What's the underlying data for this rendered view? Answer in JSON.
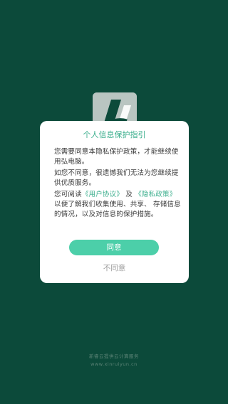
{
  "background_color": "#0c4a3a",
  "accent_color": "#3aae8c",
  "button_color": "#4ccfa9",
  "logo": {
    "icon": "app-logo-icon"
  },
  "dialog": {
    "title": "个人信息保护指引",
    "p1": "您需要同意本隐私保护政策，才能继续使 用弘电脑。",
    "p2": "如您不同意，很遗憾我们无法为您继续提 供优质服务。",
    "p3_prefix": "您可阅读",
    "user_agreement_link": "《用户协议》",
    "p3_and": "及",
    "privacy_policy_link": "《隐私政策》",
    "p3_suffix": "以便了解我们收集使用、共享、 存储信息的情况，以及对信息的保护措施。",
    "agree_label": "同意",
    "disagree_label": "不同意"
  },
  "footer": {
    "company": "新睿云提供云计算服务",
    "url": "www.xinruiyun.cn"
  }
}
